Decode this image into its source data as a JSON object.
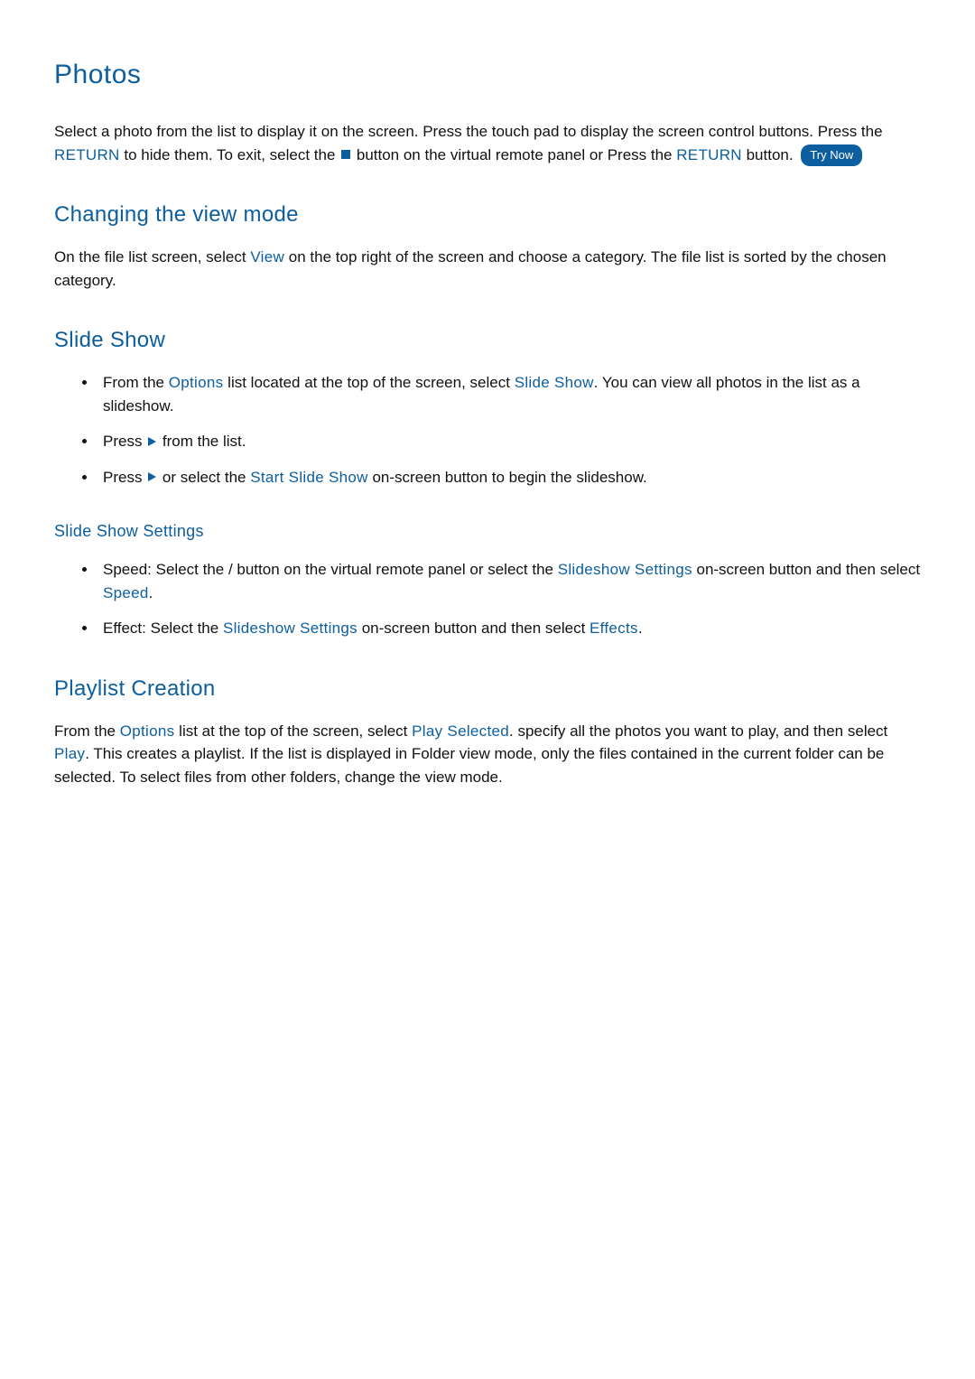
{
  "page": {
    "title": "Photos",
    "intro": {
      "text1": "Select a photo from the list to display it on the screen. Press the touch pad to display the screen control buttons. Press the ",
      "return1": "RETURN",
      "text2": " to hide them. To exit, select the ",
      "text3": " button on the virtual remote panel or Press the ",
      "return2": "RETURN",
      "text4": " button. ",
      "tryNow": "Try Now"
    },
    "section1": {
      "heading": "Changing the view mode",
      "body": {
        "text1": "On the file list screen, select ",
        "view": "View",
        "text2": " on the top right of the screen and choose a category. The file list is sorted by the chosen category."
      }
    },
    "section2": {
      "heading": "Slide Show",
      "item1": {
        "t1": "From the ",
        "options": "Options",
        "t2": " list located at the top of the screen, select ",
        "slideShow": "Slide Show",
        "t3": ". You can view all photos in the list as a slideshow."
      },
      "item2": {
        "t1": "Press ",
        "t2": " from the list."
      },
      "item3": {
        "t1": "Press ",
        "t2": " or select the ",
        "startSlideShow": "Start Slide Show",
        "t3": " on-screen button to begin the slideshow."
      },
      "sub": {
        "heading": "Slide Show Settings",
        "item1": {
          "label": "Speed",
          "t1": ": Select the   /   button on the virtual remote panel or select the ",
          "slideshowSettings": "Slideshow Settings",
          "t2": " on-screen button and then select ",
          "speed": "Speed",
          "t3": "."
        },
        "item2": {
          "label": "Effect",
          "t1": ": Select the ",
          "slideshowSettings": "Slideshow Settings",
          "t2": " on-screen button and then select ",
          "effects": "Effects",
          "t3": "."
        }
      }
    },
    "section3": {
      "heading": "Playlist Creation",
      "body": {
        "t1": "From the ",
        "options": "Options",
        "t2": " list at the top of the screen, select ",
        "playSelected": "Play Selected",
        "t3": ". specify all the photos you want to play, and then select ",
        "play": "Play",
        "t4": ". This creates a playlist. If the list is displayed in Folder view mode, only the files contained in the current folder can be selected. To select files from other folders, change the view mode."
      }
    }
  }
}
